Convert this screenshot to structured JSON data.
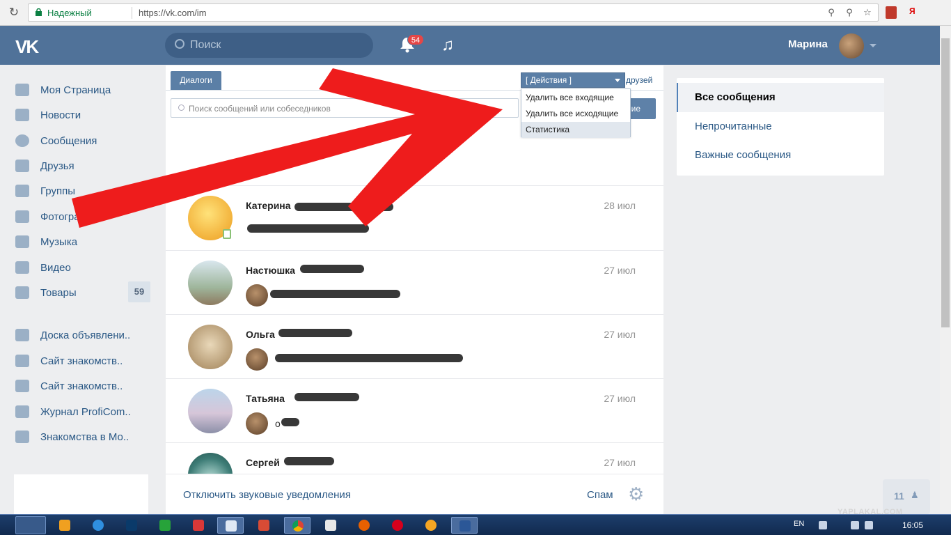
{
  "browser": {
    "secure_label": "Надежный",
    "url": "https://vk.com/im"
  },
  "header": {
    "search_placeholder": "Поиск",
    "notifications_count": "54",
    "user_name": "Марина"
  },
  "sidebar": {
    "items": [
      {
        "label": "Моя Страница"
      },
      {
        "label": "Новости"
      },
      {
        "label": "Сообщения"
      },
      {
        "label": "Друзья"
      },
      {
        "label": "Группы"
      },
      {
        "label": "Фотографии"
      },
      {
        "label": "Музыка"
      },
      {
        "label": "Видео"
      },
      {
        "label": "Товары",
        "count": "59"
      }
    ],
    "groups": [
      {
        "label": "Доска объявлени.."
      },
      {
        "label": "Сайт знакомств.."
      },
      {
        "label": "Сайт знакомств.."
      },
      {
        "label": "Журнал ProfiCom.."
      },
      {
        "label": "Знакомства в Мо.."
      }
    ]
  },
  "messages": {
    "tab_dialogs": "Диалоги",
    "tab_friends": "друзей",
    "search_placeholder": "Поиск сообщений или собеседников",
    "write_button": "ие",
    "actions_label": "[ Действия ]",
    "actions_menu": [
      "Удалить все входящие",
      "Удалить все исходящие",
      "Статистика"
    ],
    "dialogs": [
      {
        "name": "Катерина",
        "date": "28 июл",
        "preview": ""
      },
      {
        "name": "Настюшка",
        "date": "27 июл",
        "preview": ""
      },
      {
        "name": "Ольга",
        "date": "27 июл",
        "preview": ""
      },
      {
        "name": "Татьяна",
        "date": "27 июл",
        "preview": "о"
      },
      {
        "name": "Сергей",
        "date": "27 июл",
        "preview": ""
      }
    ],
    "footer": {
      "mute_label": "Отключить звуковые уведомления",
      "spam_label": "Спам"
    }
  },
  "right_menu": {
    "items": [
      "Все сообщения",
      "Непрочитанные",
      "Важные сообщения"
    ]
  },
  "chat_count": "11",
  "watermark": "YAPLAKAL.COM",
  "taskbar": {
    "lang": "EN",
    "time": "16:05"
  },
  "colors": {
    "vk_blue": "#507299",
    "arrow_red": "#ee1c1c"
  }
}
